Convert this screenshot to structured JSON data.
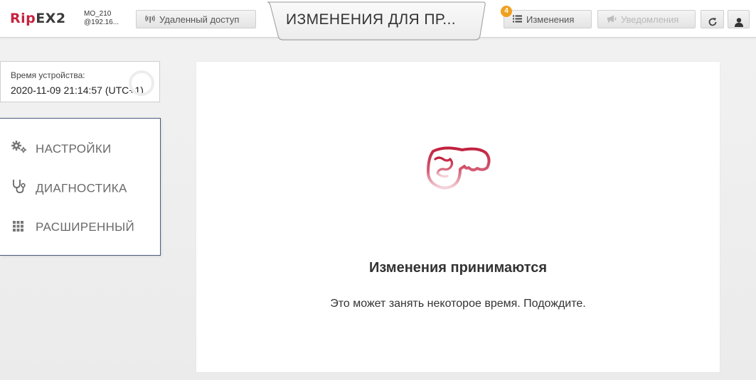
{
  "header": {
    "logo": {
      "part1": "Rip",
      "part2": "EX2"
    },
    "device": {
      "name": "MO_210",
      "address": "@192.16..."
    },
    "remote_access_label": "Удаленный доступ",
    "title": "ИЗМЕНЕНИЯ ДЛЯ ПР...",
    "changes_label": "Изменения",
    "changes_count": "4",
    "notifications_label": "Уведомления"
  },
  "sidebar": {
    "time_label": "Время устройства:",
    "time_value": "2020-11-09 21:14:57 (UTC+1)",
    "menu": [
      {
        "label": "НАСТРОЙКИ",
        "icon": "gears-icon"
      },
      {
        "label": "ДИАГНОСТИКА",
        "icon": "stethoscope-icon"
      },
      {
        "label": "РАСШИРЕННЫЙ",
        "icon": "grid-icon"
      }
    ]
  },
  "main": {
    "status_title": "Изменения принимаются",
    "status_subtitle": "Это может занять некоторое время. Подождите."
  },
  "colors": {
    "brand_red": "#c8223f",
    "badge_orange": "#f0a020",
    "menu_border": "#4a5b7a"
  }
}
